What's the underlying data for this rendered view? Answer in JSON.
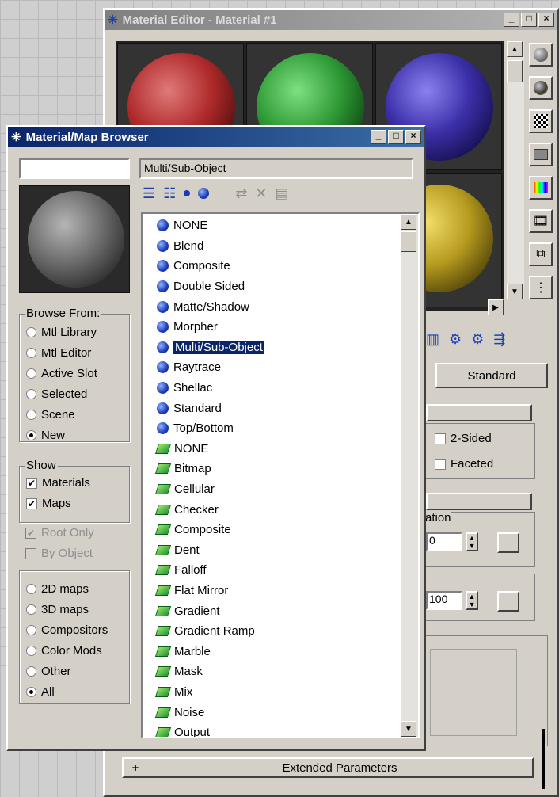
{
  "material_editor": {
    "title": "Material Editor - Material #1",
    "controls": {
      "minimize": "_",
      "maximize": "□",
      "close": "×"
    },
    "slots": [
      {
        "color": "#b02a2a"
      },
      {
        "color": "#2e9a35"
      },
      {
        "color": "#3b2fa8"
      },
      {
        "color": "#555555"
      },
      {
        "color": "#555555"
      },
      {
        "color": "#b59a1e"
      }
    ],
    "side_tools": [
      "sample-type-icon",
      "backlight-icon",
      "background-checker-icon",
      "sample-uv-icon",
      "video-color-check-icon",
      "make-preview-icon",
      "options-icon",
      "select-by-material-icon"
    ],
    "type_button": "Standard",
    "checkboxes": [
      {
        "label": "2-Sided"
      },
      {
        "label": "Faceted"
      }
    ],
    "partial_label": "ation",
    "spinner_1_value": "0",
    "spinner_2_value": "100",
    "extended_rollout": {
      "sign": "+",
      "label": "Extended Parameters"
    }
  },
  "browser": {
    "title": "Material/Map Browser",
    "controls": {
      "minimize": "_",
      "maximize": "□",
      "close": "×"
    },
    "name_field": "",
    "path_field": "Multi/Sub-Object",
    "browse_from": {
      "label": "Browse From:",
      "options": [
        "Mtl Library",
        "Mtl Editor",
        "Active Slot",
        "Selected",
        "Scene",
        "New"
      ],
      "selected": "New"
    },
    "show": {
      "label": "Show",
      "options": [
        {
          "label": "Materials",
          "checked": true,
          "disabled": false
        },
        {
          "label": "Maps",
          "checked": true,
          "disabled": false
        },
        {
          "label": "Root Only",
          "checked": true,
          "disabled": true
        },
        {
          "label": "By Object",
          "checked": false,
          "disabled": true
        }
      ]
    },
    "map_filter": {
      "options": [
        "2D maps",
        "3D maps",
        "Compositors",
        "Color Mods",
        "Other",
        "All"
      ],
      "selected": "All"
    },
    "list": {
      "selected": "Multi/Sub-Object",
      "items": [
        {
          "label": "NONE",
          "kind": "material"
        },
        {
          "label": "Blend",
          "kind": "material"
        },
        {
          "label": "Composite",
          "kind": "material"
        },
        {
          "label": "Double Sided",
          "kind": "material"
        },
        {
          "label": "Matte/Shadow",
          "kind": "material"
        },
        {
          "label": "Morpher",
          "kind": "material"
        },
        {
          "label": "Multi/Sub-Object",
          "kind": "material"
        },
        {
          "label": "Raytrace",
          "kind": "material"
        },
        {
          "label": "Shellac",
          "kind": "material"
        },
        {
          "label": "Standard",
          "kind": "material"
        },
        {
          "label": "Top/Bottom",
          "kind": "material"
        },
        {
          "label": "NONE",
          "kind": "map"
        },
        {
          "label": "Bitmap",
          "kind": "map"
        },
        {
          "label": "Cellular",
          "kind": "map"
        },
        {
          "label": "Checker",
          "kind": "map"
        },
        {
          "label": "Composite",
          "kind": "map"
        },
        {
          "label": "Dent",
          "kind": "map"
        },
        {
          "label": "Falloff",
          "kind": "map"
        },
        {
          "label": "Flat Mirror",
          "kind": "map"
        },
        {
          "label": "Gradient",
          "kind": "map"
        },
        {
          "label": "Gradient Ramp",
          "kind": "map"
        },
        {
          "label": "Marble",
          "kind": "map"
        },
        {
          "label": "Mask",
          "kind": "map"
        },
        {
          "label": "Mix",
          "kind": "map"
        },
        {
          "label": "Noise",
          "kind": "map"
        },
        {
          "label": "Output",
          "kind": "map"
        }
      ]
    }
  }
}
